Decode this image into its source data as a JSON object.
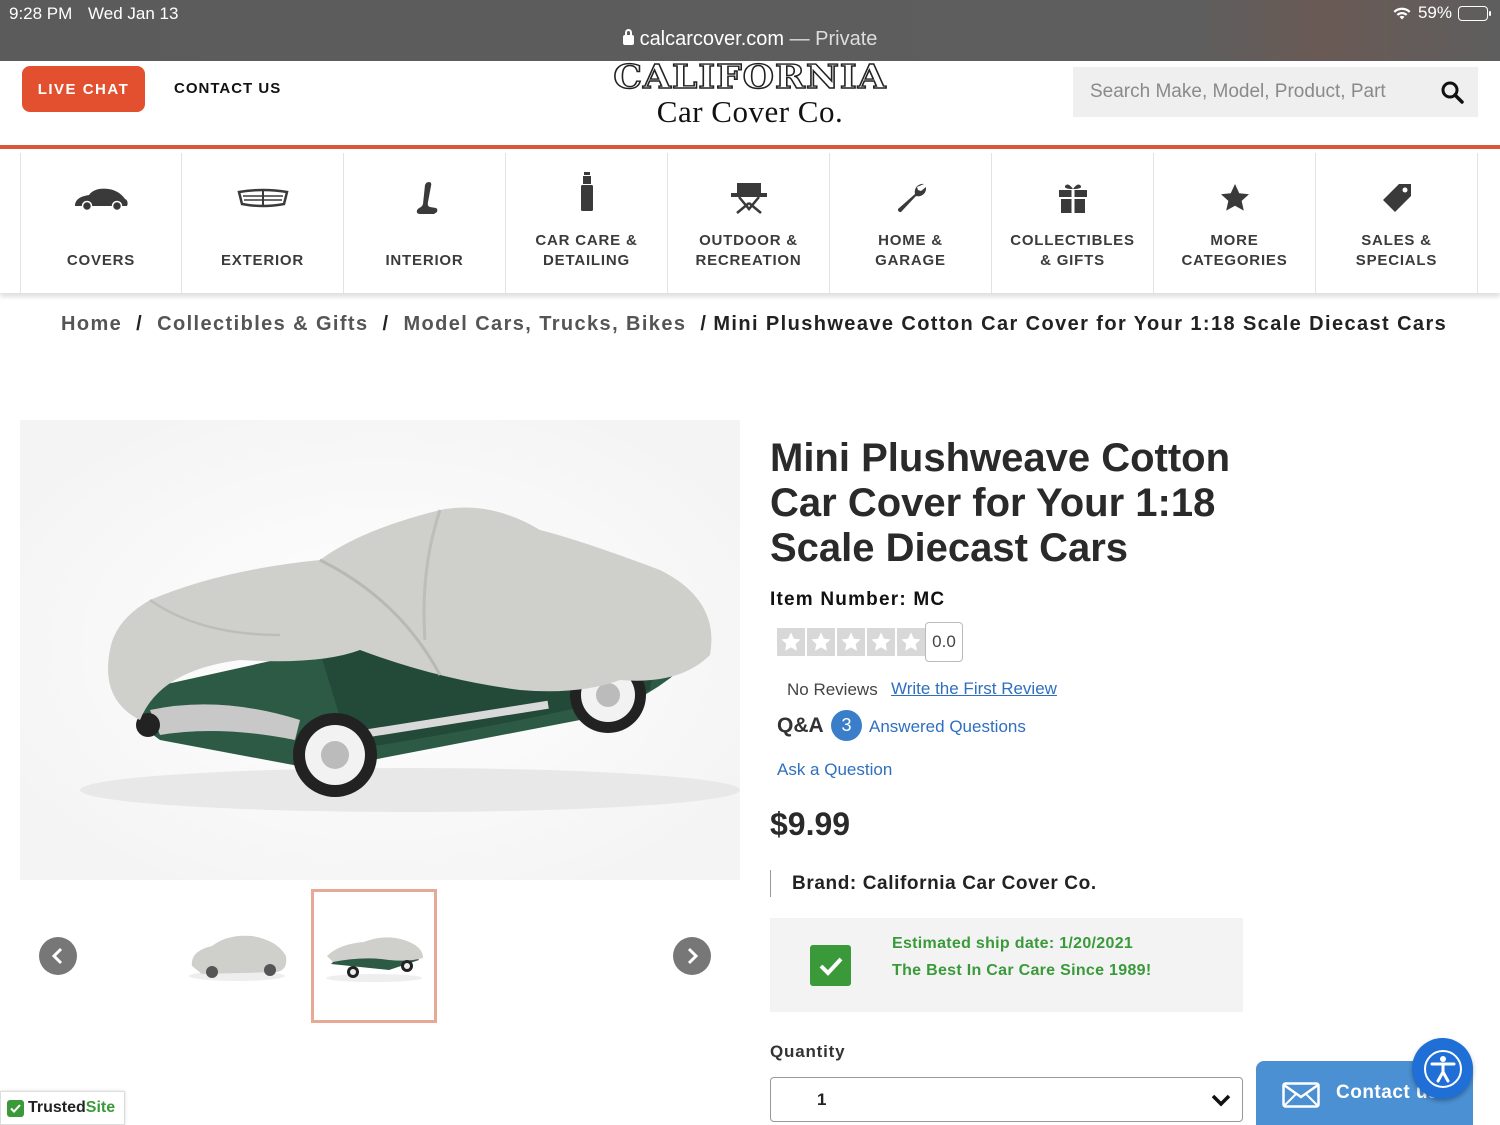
{
  "status_bar": {
    "time": "9:28 PM",
    "date": "Wed Jan 13",
    "battery": "59%",
    "battery_level": 0.59,
    "url": "calcarcover.com",
    "url_suffix": "— Private"
  },
  "header": {
    "live_chat": "LIVE CHAT",
    "contact_us": "CONTACT US",
    "logo_top": "CALIFORNIA",
    "logo_bottom": "Car Cover Co.",
    "search_placeholder": "Search Make, Model, Product, Part",
    "accent_color": "#e2502f"
  },
  "nav": {
    "items": [
      {
        "label": "COVERS",
        "icon": "car-cover-icon"
      },
      {
        "label": "EXTERIOR",
        "icon": "grille-icon"
      },
      {
        "label": "INTERIOR",
        "icon": "seat-icon"
      },
      {
        "label": "CAR CARE &\nDETAILING",
        "icon": "spray-bottle-icon"
      },
      {
        "label": "OUTDOOR &\nRECREATION",
        "icon": "camp-chair-icon"
      },
      {
        "label": "HOME &\nGARAGE",
        "icon": "wrench-icon"
      },
      {
        "label": "COLLECTIBLES\n& GIFTS",
        "icon": "gift-icon"
      },
      {
        "label": "MORE\nCATEGORIES",
        "icon": "star-icon"
      },
      {
        "label": "SALES &\nSPECIALS",
        "icon": "price-tag-icon"
      }
    ]
  },
  "breadcrumb": {
    "home": "Home",
    "level1": "Collectibles & Gifts",
    "level2": "Model Cars, Trucks, Bikes",
    "current": "Mini Plushweave Cotton Car Cover for Your 1:18 Scale Diecast Cars"
  },
  "product": {
    "title": "Mini Plushweave Cotton Car Cover for Your 1:18 Scale Diecast Cars",
    "item_number": "Item Number: MC",
    "rating": "0.0",
    "rating_stars": 0,
    "no_reviews": "No Reviews",
    "write_review": "Write the First Review",
    "qa_label": "Q&A",
    "qa_count": "3",
    "qa_text": "Answered Questions",
    "ask_question": "Ask a Question",
    "price": "$9.99",
    "brand": "Brand: California Car Cover Co.",
    "ship_date": "Estimated ship date: 1/20/2021",
    "tagline": "The Best In Car Care Since 1989!",
    "quantity_label": "Quantity",
    "quantity_value": "1"
  },
  "floating": {
    "contact": "Contact us",
    "trusted": "Trusted",
    "trusted_site": "Site"
  }
}
